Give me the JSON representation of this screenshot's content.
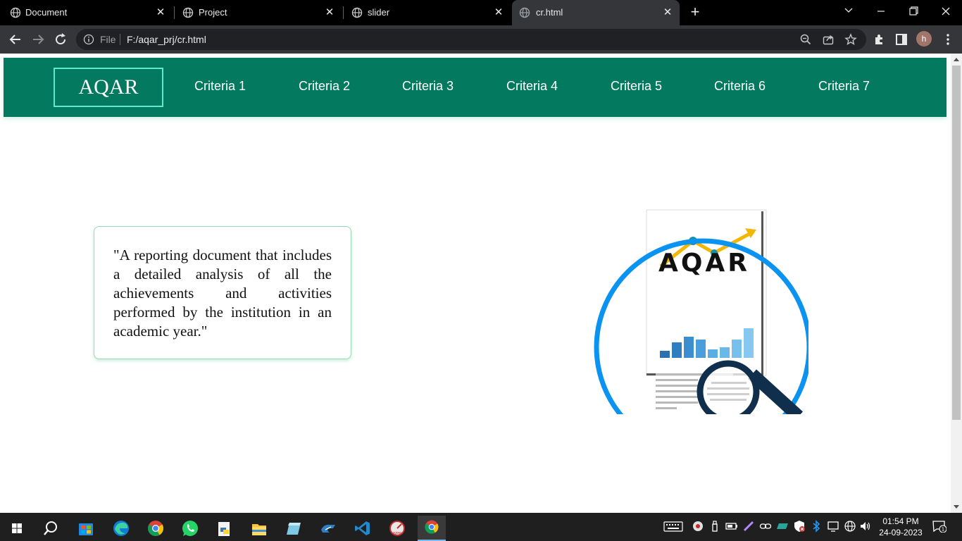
{
  "browser": {
    "tabs": [
      {
        "title": "Document",
        "active": false
      },
      {
        "title": "Project",
        "active": false
      },
      {
        "title": "slider",
        "active": false
      },
      {
        "title": "cr.html",
        "active": true
      }
    ],
    "address": {
      "scheme_label": "File",
      "url": "F:/aqar_prj/cr.html"
    },
    "profile_initial": "h"
  },
  "page": {
    "brand": "AQAR",
    "nav": [
      "Criteria 1",
      "Criteria 2",
      "Criteria 3",
      "Criteria 4",
      "Criteria 5",
      "Criteria 6",
      "Criteria 7"
    ],
    "quote": "\"A reporting document that includes a detailed analysis of all the achievements and activities performed by the institution in an academic year.\"",
    "illustration_text": "AQAR"
  },
  "taskbar": {
    "time": "01:54 PM",
    "date": "24-09-2023",
    "notification_count": "1"
  },
  "colors": {
    "navbar": "#037a5f",
    "brand_border": "#5eeacb",
    "ring": "#0a93f0",
    "magnifier": "#0f2f4d"
  }
}
